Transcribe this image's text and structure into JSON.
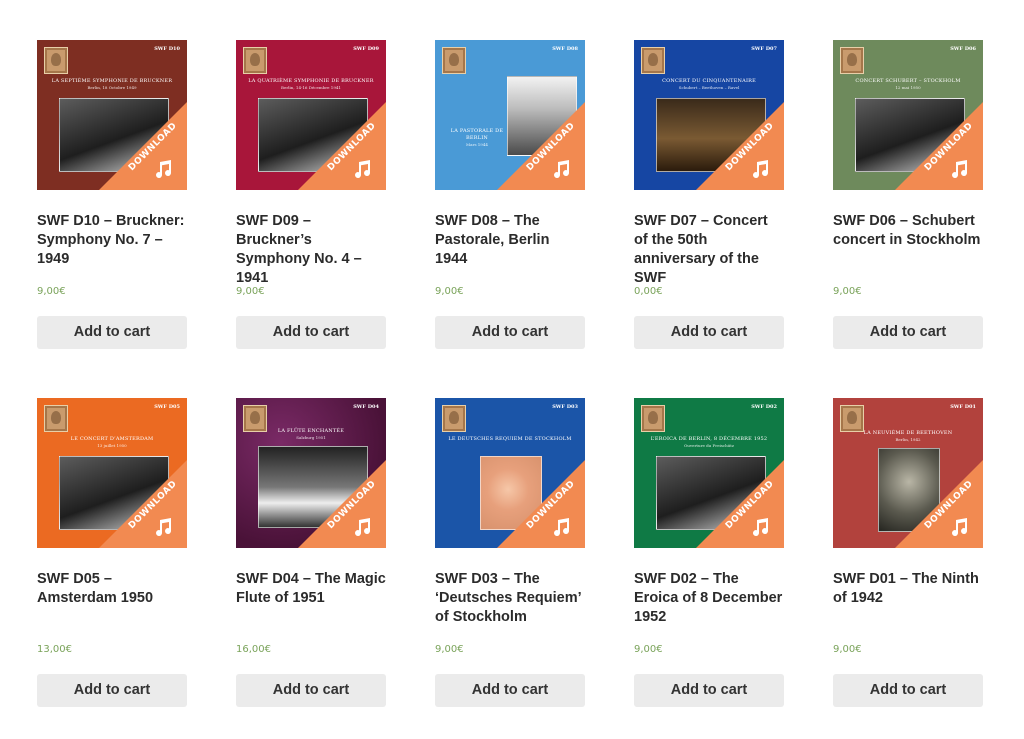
{
  "products": [
    {
      "title": "SWF D10 – Bruckner: Symphony No. 7 – 1949",
      "price": "9,00€",
      "button": "Add to cart",
      "cover_code": "SWF D10",
      "cover_title": "LA SEPTIÈME SYMPHONIE DE BRUCKNER",
      "cover_sub": "Berlin, 18 Octobre 1949",
      "cover_color": "#7e2e22",
      "banner_label": "DOWNLOAD"
    },
    {
      "title": "SWF D09 – Bruckner’s Symphony No. 4 – 1941",
      "price": "9,00€",
      "button": "Add to cart",
      "cover_code": "SWF D09",
      "cover_title": "LA QUATRIÈME SYMPHONIE DE BRUCKNER",
      "cover_sub": "Berlin, 14-16 Décembre 1941",
      "cover_color": "#a8163a",
      "banner_label": "DOWNLOAD"
    },
    {
      "title": "SWF D08 – The Pastorale, Berlin 1944",
      "price": "9,00€",
      "button": "Add to cart",
      "cover_code": "SWF D08",
      "cover_title": "LA PASTORALE DE BERLIN",
      "cover_sub": "Mars 1944",
      "cover_color": "#4a9ad6",
      "banner_label": "DOWNLOAD"
    },
    {
      "title": "SWF D07 – Concert of the 50th anniversary of the SWF",
      "price": "0,00€",
      "button": "Add to cart",
      "cover_code": "SWF D07",
      "cover_title": "CONCERT DU CINQUANTENAIRE",
      "cover_sub": "Schubert – Beethoven – Ravel",
      "cover_color": "#1646a3",
      "banner_label": "DOWNLOAD"
    },
    {
      "title": "SWF D06 – Schubert concert in Stockholm",
      "price": "9,00€",
      "button": "Add to cart",
      "cover_code": "SWF D06",
      "cover_title": "CONCERT SCHUBERT – STOCKHOLM",
      "cover_sub": "12 mai 1950",
      "cover_color": "#6e8a5c",
      "banner_label": "DOWNLOAD"
    },
    {
      "title": "SWF D05 – Amsterdam 1950",
      "price": "13,00€",
      "button": "Add to cart",
      "cover_code": "SWF D05",
      "cover_title": "LE CONCERT D’AMSTERDAM",
      "cover_sub": "13 juillet 1950",
      "cover_color": "#eb6a22",
      "banner_label": "DOWNLOAD"
    },
    {
      "title": "SWF D04 – The Magic Flute of 1951",
      "price": "16,00€",
      "button": "Add to cart",
      "cover_code": "SWF D04",
      "cover_title": "LA FLÛTE ENCHANTÉE",
      "cover_sub": "Salzburg 1951",
      "cover_color": "#5a1a4a",
      "banner_label": "DOWNLOAD"
    },
    {
      "title": "SWF D03 – The ‘Deutsches Requiem’ of Stockholm",
      "price": "9,00€",
      "button": "Add to cart",
      "cover_code": "SWF D03",
      "cover_title": "LE DEUTSCHES REQUIEM DE STOCKHOLM",
      "cover_sub": "",
      "cover_color": "#1b55a8",
      "banner_label": "DOWNLOAD"
    },
    {
      "title": "SWF D02 – The Eroica of 8 December 1952",
      "price": "9,00€",
      "button": "Add to cart",
      "cover_code": "SWF D02",
      "cover_title": "L’EROICA DE BERLIN, 8 DÉCEMBRE 1952",
      "cover_sub": "Ouverture du Freischütz",
      "cover_color": "#0f7a45",
      "banner_label": "DOWNLOAD"
    },
    {
      "title": "SWF D01 – The Ninth of 1942",
      "price": "9,00€",
      "button": "Add to cart",
      "cover_code": "SWF D01",
      "cover_title": "LA NEUVIÈME DE BEETHOVEN",
      "cover_sub": "Berlin, 1942",
      "cover_color": "#b2423d",
      "banner_label": "DOWNLOAD"
    }
  ]
}
